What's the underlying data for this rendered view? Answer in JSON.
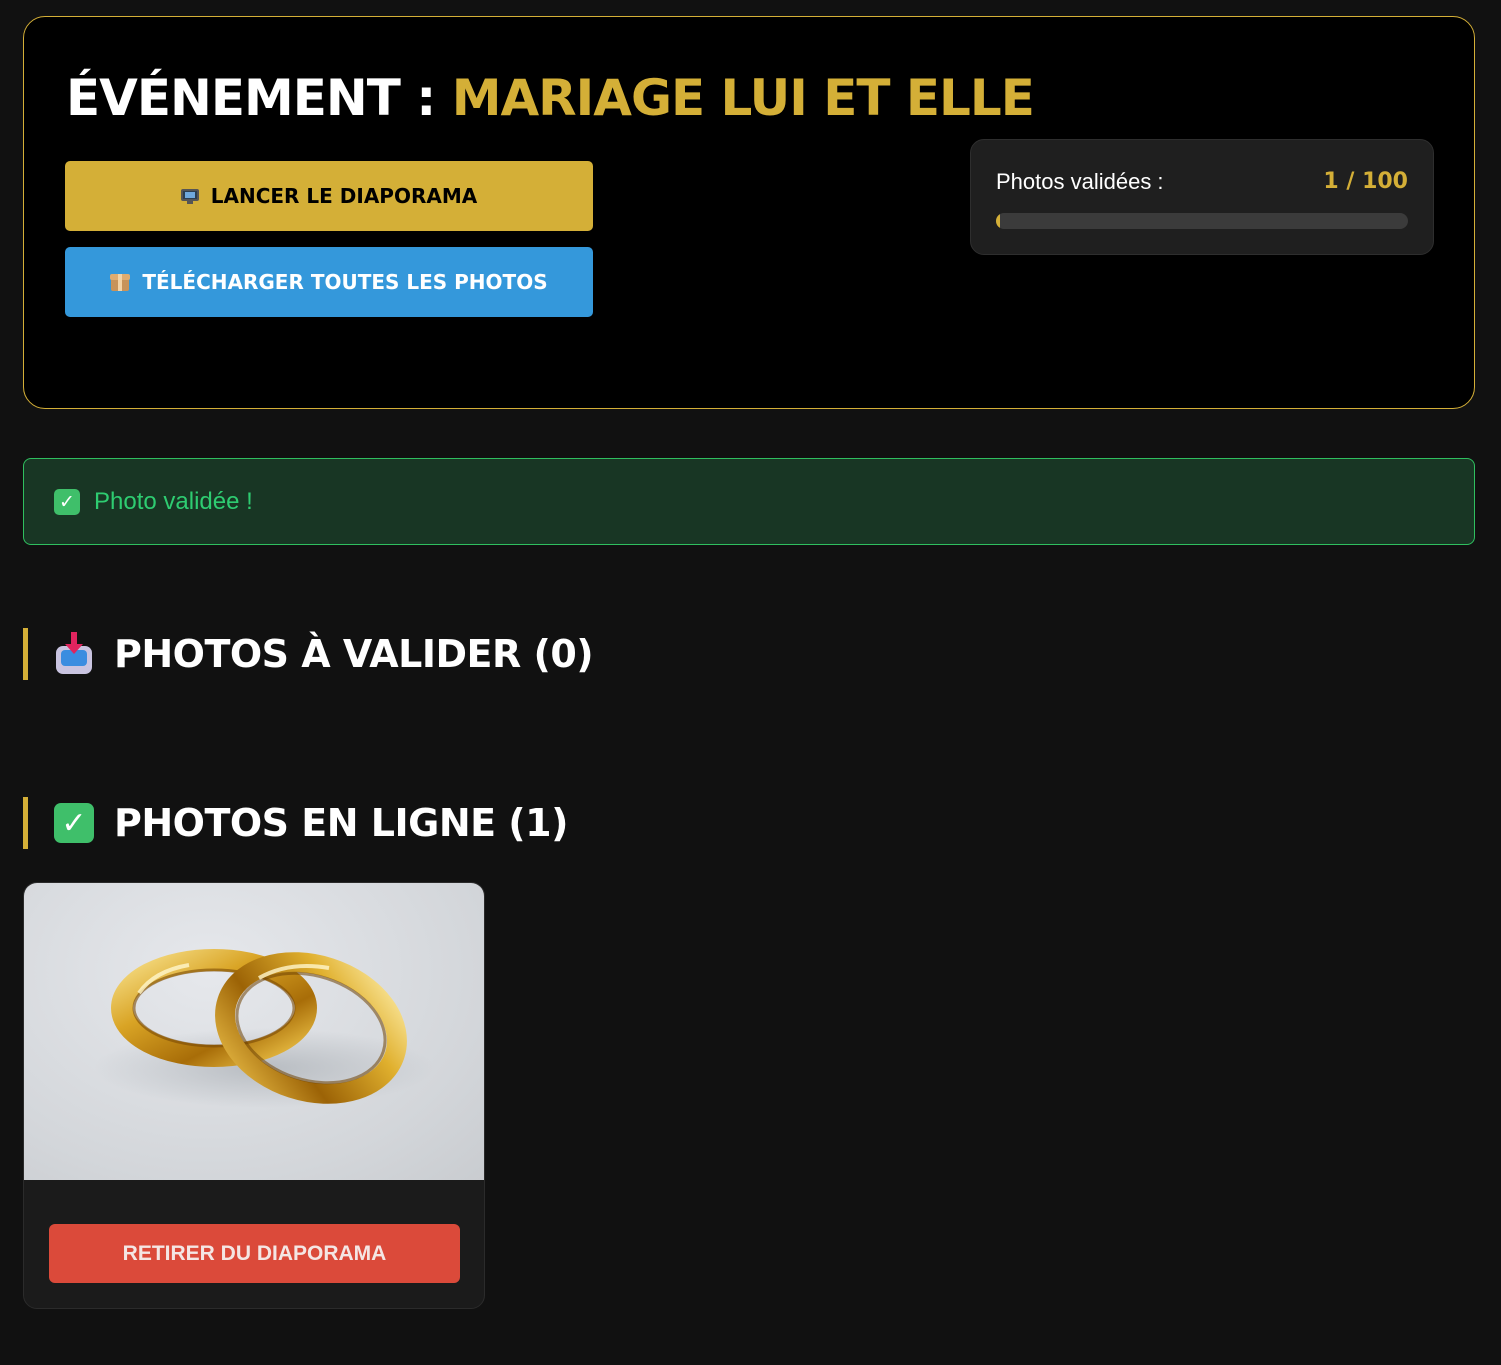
{
  "event": {
    "title_prefix": "ÉVÉNEMENT : ",
    "title_name": "MARIAGE LUI ET ELLE"
  },
  "actions": {
    "slideshow_label": "LANCER LE DIAPORAMA",
    "download_label": "TÉLÉCHARGER TOUTES LES PHOTOS"
  },
  "stats": {
    "label": "Photos validées :",
    "count_text": "1 / 100",
    "validated": 1,
    "total": 100
  },
  "alert": {
    "text": "Photo validée !"
  },
  "sections": {
    "pending_title": "PHOTOS À VALIDER (0)",
    "online_title": "PHOTOS EN LIGNE (1)"
  },
  "online_photos": [
    {
      "subject": "golden wedding rings",
      "remove_label": "RETIRER DU DIAPORAMA"
    }
  ],
  "colors": {
    "accent_gold": "#d4af37",
    "download_blue": "#3498db",
    "success_green": "#2ecc71",
    "danger_red": "#db4a3a",
    "background": "#111111"
  },
  "icons": {
    "slideshow": "tv-icon",
    "download": "package-icon",
    "alert": "check-mark-icon",
    "pending_section": "inbox-tray-icon",
    "online_section": "check-mark-icon"
  }
}
